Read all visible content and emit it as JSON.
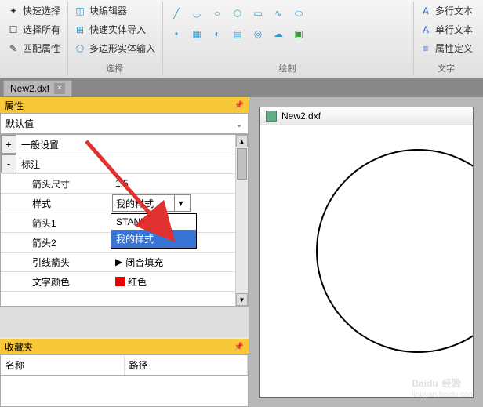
{
  "ribbon": {
    "group1": {
      "quick_select": "快速选择",
      "select_all": "选择所有",
      "match_props": "匹配属性",
      "edit_fill": "块编辑器",
      "solid_import": "快速实体导入",
      "polygon_input": "多边形实体输入",
      "label": "选择"
    },
    "group2": {
      "label": "绘制"
    },
    "group3": {
      "multi_text": "多行文本",
      "single_text": "单行文本",
      "attr_def": "属性定义",
      "label": "文字"
    }
  },
  "tab": {
    "name": "New2.dxf"
  },
  "props_panel": {
    "title": "属性",
    "default_label": "默认值",
    "sections": {
      "general": "一般设置",
      "annotation": "标注"
    },
    "rows": {
      "arrow_size": {
        "label": "箭头尺寸",
        "value": "1.5"
      },
      "style": {
        "label": "样式",
        "value": "我的样式"
      },
      "arrow1": {
        "label": "箭头1"
      },
      "arrow2": {
        "label": "箭头2"
      },
      "leader_arrow": {
        "label": "引线箭头",
        "value": "闭合填充"
      },
      "text_color": {
        "label": "文字颜色",
        "value": "红色"
      }
    },
    "dropdown": {
      "opt1": "STANDARD",
      "opt2": "我的样式"
    }
  },
  "favorites": {
    "title": "收藏夹",
    "col_name": "名称",
    "col_path": "路径"
  },
  "canvas": {
    "doc_title": "New2.dxf"
  },
  "watermark": {
    "brand": "Baidu",
    "sub": "jingyan.baidu.com",
    "tag": "经验"
  }
}
